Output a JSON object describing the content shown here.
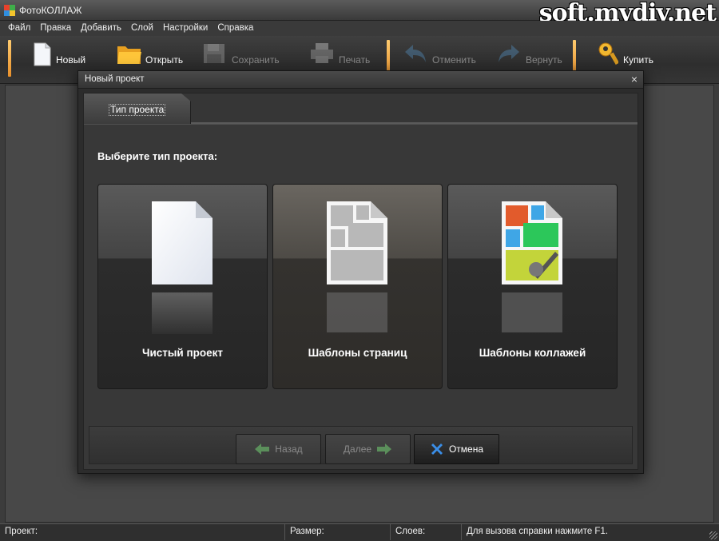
{
  "window": {
    "title": "ФотоКОЛЛАЖ",
    "watermark": "soft.mydiv.net"
  },
  "menu": [
    "Файл",
    "Правка",
    "Добавить",
    "Слой",
    "Настройки",
    "Справка"
  ],
  "toolbar": {
    "new_label": "Новый",
    "open_label": "Открыть",
    "save_label": "Сохранить",
    "print_label": "Печать",
    "undo_label": "Отменить",
    "redo_label": "Вернуть",
    "buy_label": "Купить"
  },
  "dialog": {
    "title": "Новый проект",
    "tab_label": "Тип проекта",
    "heading": "Выберите тип проекта:",
    "cards": [
      {
        "label": "Чистый проект",
        "icon": "blank-page-icon"
      },
      {
        "label": "Шаблоны страниц",
        "icon": "page-templates-icon"
      },
      {
        "label": "Шаблоны коллажей",
        "icon": "collage-templates-icon"
      }
    ],
    "back_label": "Назад",
    "next_label": "Далее",
    "cancel_label": "Отмена"
  },
  "status": {
    "project": "Проект:",
    "size": "Размер:",
    "layers": "Слоев:",
    "hint": "Для вызова справки нажмите F1."
  },
  "colors": {
    "accent_orange": "#f0a040",
    "cancel_blue": "#3a8ee8",
    "arrow_green": "#5fa05f"
  }
}
